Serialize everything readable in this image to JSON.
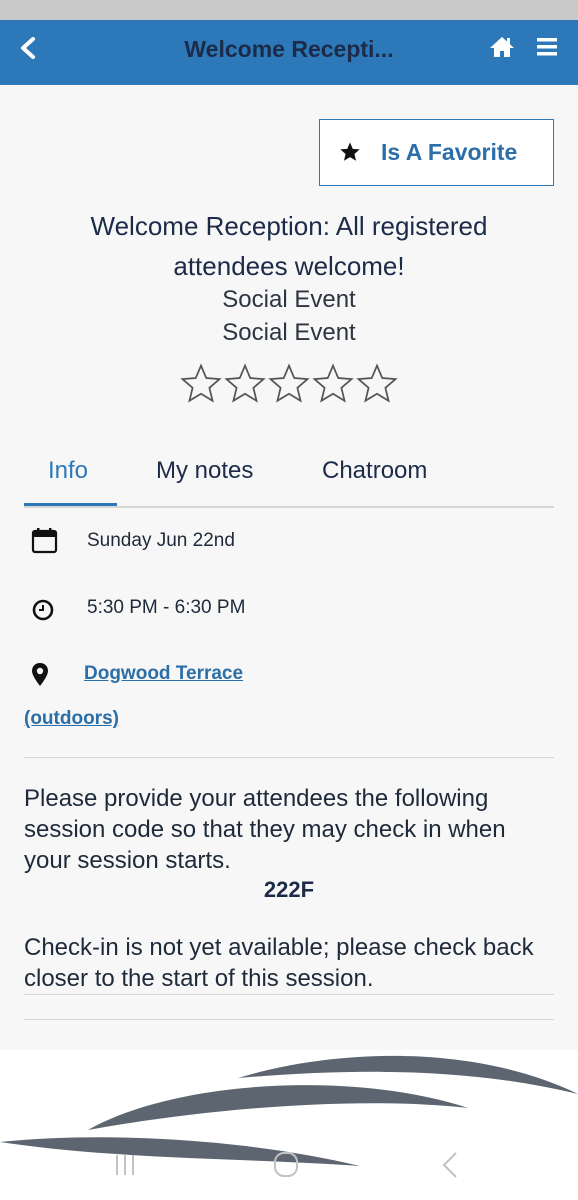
{
  "header": {
    "title": "Welcome Recepti...",
    "back_icon": "chevron-left-icon",
    "home_icon": "home-icon",
    "menu_icon": "hamburger-menu-icon"
  },
  "favorite": {
    "label": "Is A Favorite",
    "icon": "star-filled-icon"
  },
  "event": {
    "title": "Welcome Reception: All registered attendees welcome!",
    "subtitle_1": "Social Event",
    "subtitle_2": "Social Event",
    "rating_max": 5,
    "rating_value": 0
  },
  "tabs": [
    {
      "label": "Info",
      "active": true
    },
    {
      "label": "My notes",
      "active": false
    },
    {
      "label": "Chatroom",
      "active": false
    }
  ],
  "info": {
    "date": "Sunday Jun 22nd",
    "time": "5:30 PM - 6:30 PM",
    "location_line1": "Dogwood Terrace",
    "location_line2": "(outdoors)"
  },
  "checkin": {
    "instructions": "Please provide your attendees the following session code so that they may check in when your session starts.",
    "code": "222F",
    "status": "Check-in is not yet available; please check back closer to the start of this session."
  },
  "colors": {
    "header_bg": "#2c78b8",
    "accent": "#2c78b8",
    "link": "#2b6ea8",
    "title_text": "#1b2b48",
    "wave": "#5c6570"
  },
  "system_nav": {
    "recents_icon": "recent-apps-icon",
    "home_icon": "home-circle-icon",
    "back_icon": "back-chevron-icon"
  }
}
